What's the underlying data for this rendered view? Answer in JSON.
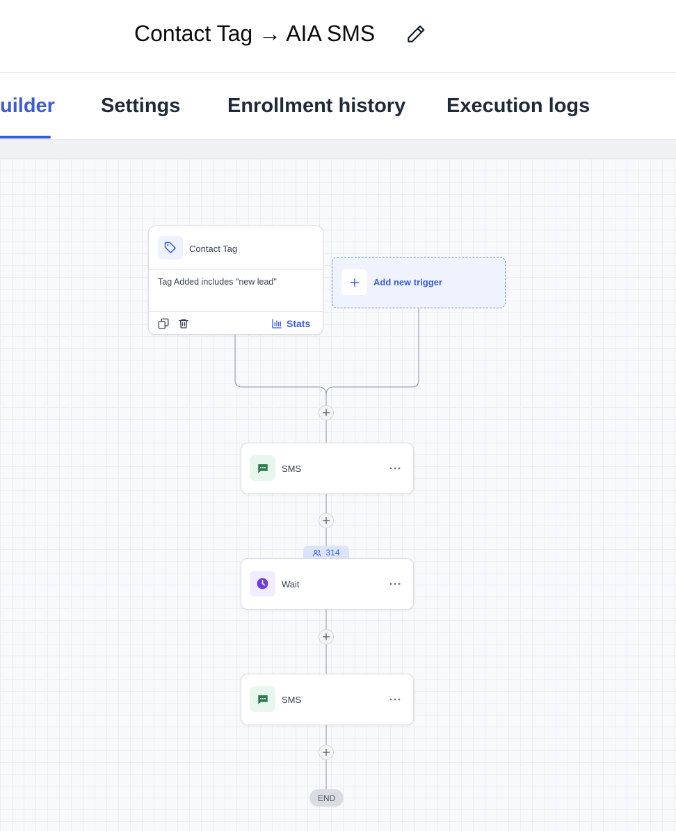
{
  "header": {
    "title": "Contact Tag → AIA SMS"
  },
  "tabs": [
    {
      "label": "uilder"
    },
    {
      "label": "Settings"
    },
    {
      "label": "Enrollment history"
    },
    {
      "label": "Execution logs"
    }
  ],
  "trigger": {
    "title": "Contact Tag",
    "description": "Tag Added includes \"new lead\"",
    "stats_label": "Stats",
    "icon": "tag-icon"
  },
  "add_trigger": {
    "label": "Add new trigger"
  },
  "actions": [
    {
      "label": "SMS",
      "icon": "sms-icon",
      "color": "#2f7d4f"
    },
    {
      "label": "Wait",
      "icon": "clock-icon",
      "color": "#6d3fd8"
    },
    {
      "label": "SMS",
      "icon": "sms-icon",
      "color": "#2f7d4f"
    }
  ],
  "count_badge": {
    "value": "314"
  },
  "end_label": "END",
  "colors": {
    "accent": "#3b5bdb",
    "sms_green": "#2f7d4f",
    "wait_purple": "#6d3fd8"
  }
}
